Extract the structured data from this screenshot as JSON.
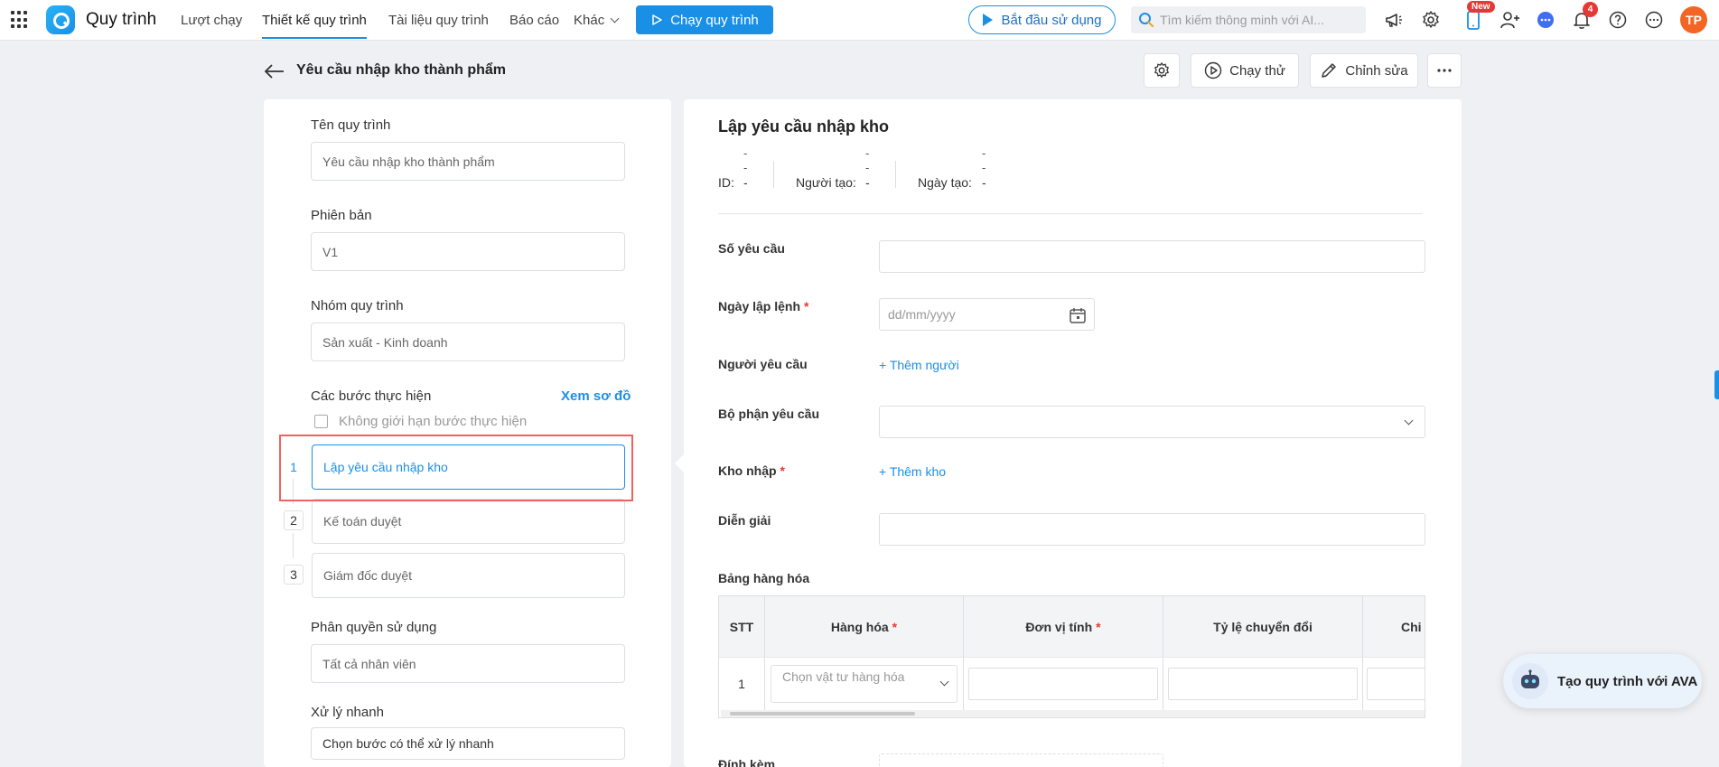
{
  "topbar": {
    "app_name": "Quy trình",
    "nav": [
      "Lượt chạy",
      "Thiết kế quy trình",
      "Tài liệu quy trình",
      "Báo cáo",
      "Khác"
    ],
    "run_button": "Chạy quy trình",
    "start_button": "Bắt đầu sử dụng",
    "search_placeholder": "Tìm kiếm thông minh với AI...",
    "new_badge": "New",
    "notification_count": "4",
    "avatar_initials": "TP"
  },
  "header": {
    "title": "Yêu cầu nhập kho thành phẩm",
    "test_run_label": "Chạy thử",
    "edit_label": "Chỉnh sửa"
  },
  "left": {
    "name_label": "Tên quy trình",
    "name_value": "Yêu cầu nhập kho thành phẩm",
    "version_label": "Phiên bản",
    "version_value": "V1",
    "group_label": "Nhóm quy trình",
    "group_value": "Sản xuất - Kinh doanh",
    "steps_label": "Các bước thực hiện",
    "view_diagram": "Xem sơ đồ",
    "unlimited_label": "Không giới hạn bước thực hiện",
    "steps": [
      {
        "num": "1",
        "name": "Lập yêu cầu nhập kho"
      },
      {
        "num": "2",
        "name": "Kế toán duyệt"
      },
      {
        "num": "3",
        "name": "Giám đốc duyệt"
      }
    ],
    "permission_label": "Phân quyền sử dụng",
    "permission_value": "Tất cả nhân viên",
    "quick_label": "Xử lý nhanh",
    "quick_value": "Chọn bước có thể xử lý nhanh"
  },
  "form": {
    "title": "Lập yêu cầu nhập kho",
    "dash": "-",
    "id_label": "ID:",
    "creator_label": "Người tạo:",
    "created_label": "Ngày tạo:",
    "request_no_label": "Số yêu cầu",
    "order_date_label": "Ngày lập lệnh",
    "date_placeholder": "dd/mm/yyyy",
    "requester_label": "Người yêu cầu",
    "add_person": "Thêm người",
    "department_label": "Bộ phận yêu cầu",
    "warehouse_label": "Kho nhập",
    "add_warehouse": "Thêm kho",
    "description_label": "Diễn giải",
    "goods_table_label": "Bảng hàng hóa",
    "attach_label": "Đính kèm",
    "required_mark": "*"
  },
  "table": {
    "headers": {
      "stt": "STT",
      "goods": "Hàng hóa",
      "unit": "Đơn vị tính",
      "ratio": "Tỷ lệ chuyển đổi",
      "more": "Chi"
    },
    "rows": [
      {
        "stt": "1",
        "goods_placeholder": "Chọn vật tư hàng hóa"
      }
    ]
  },
  "ava_button": "Tạo quy trình với AVA",
  "colors": {
    "accent": "#1a8fe6",
    "danger": "#e53935",
    "avatar": "#f26522"
  }
}
